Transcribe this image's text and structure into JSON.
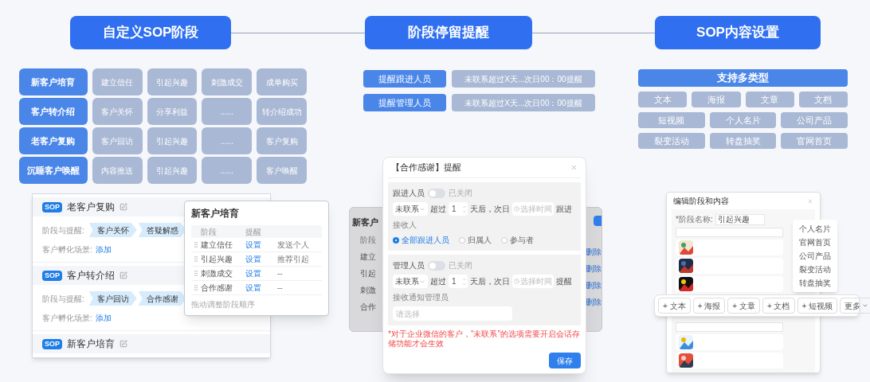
{
  "header_steps": [
    "自定义SOP阶段",
    "阶段停留提醒",
    "SOP内容设置"
  ],
  "sop_stages": [
    {
      "name": "新客户培育",
      "steps": [
        "建立信任",
        "引起兴趣",
        "刺激成交",
        "成单购买"
      ]
    },
    {
      "name": "客户转介绍",
      "steps": [
        "客户关怀",
        "分享利益",
        "......",
        "转介绍成功"
      ]
    },
    {
      "name": "老客户复购",
      "steps": [
        "客户回访",
        "引起兴趣",
        "......",
        "客户复购"
      ]
    },
    {
      "name": "沉睡客户唤醒",
      "steps": [
        "内容推送",
        "引起兴趣",
        "......",
        "客户唤醒"
      ]
    }
  ],
  "sop_list": [
    {
      "badge": "SOP",
      "title": "老客户复购",
      "stage_label": "阶段与提醒:",
      "stages": [
        "客户关怀",
        "答疑解惑"
      ],
      "scenario_label": "客户孵化场景:",
      "scenario_link": "添加"
    },
    {
      "badge": "SOP",
      "title": "客户转介绍",
      "stage_label": "阶段与提醒:",
      "stages": [
        "客户回访",
        "合作感谢"
      ],
      "scenario_label": "客户孵化场景:",
      "scenario_link": "添加"
    },
    {
      "badge": "SOP",
      "title": "新客户培育"
    }
  ],
  "stage_table": {
    "title": "新客户培育",
    "columns": [
      "阶段",
      "提醒"
    ],
    "rows": [
      {
        "stage": "建立信任",
        "action": "设置",
        "column_3": "发送个人"
      },
      {
        "stage": "引起兴趣",
        "action": "设置",
        "column_3": "推荐引起"
      },
      {
        "stage": "刺激成交",
        "action": "设置",
        "column_3": "--"
      },
      {
        "stage": "合作感谢",
        "action": "设置",
        "column_3": "--"
      }
    ],
    "footer": "拖动调整阶段顺序"
  },
  "reminders": [
    {
      "label": "提醒跟进人员",
      "value": "未联系超过X天...次日00：00提醒"
    },
    {
      "label": "提醒管理人员",
      "value": "未联系超过X天...次日00：00提醒"
    }
  ],
  "background_table": {
    "title": "新客户",
    "column_1": "阶段",
    "rows": [
      {
        "stage": "建立",
        "action": "删除"
      },
      {
        "stage": "引起",
        "action": "删除"
      },
      {
        "stage": "刺激",
        "action": "删除"
      },
      {
        "stage": "合作",
        "action": "删除"
      }
    ]
  },
  "dialog": {
    "title": "【合作感谢】提醒",
    "groups": [
      {
        "label": "跟进人员",
        "on": false,
        "state_text": "已关闭",
        "condition": "未联系",
        "over": "超过",
        "days": "1",
        "after": "天后，次日",
        "time_placeholder": "选择时间",
        "action": "跟进",
        "recipient_label": "接收人",
        "recipients": [
          {
            "label": "全部跟进人员",
            "selected": true
          },
          {
            "label": "归属人",
            "selected": false
          },
          {
            "label": "参与者",
            "selected": false
          }
        ]
      },
      {
        "label": "管理人员",
        "on": false,
        "state_text": "已关闭",
        "condition": "未联系",
        "over": "超过",
        "days": "1",
        "after": "天后，次日",
        "time_placeholder": "选择时间",
        "action": "提醒",
        "recipient_label": "接收通知管理员",
        "select_placeholder": "请选择"
      }
    ],
    "note": "*对于企业微信的客户，\"未联系\"的选项需要开启会话存储功能才会生效",
    "save": "保存"
  },
  "content_types": {
    "title": "支持多类型",
    "rows": [
      [
        "文本",
        "海报",
        "文章",
        "文档"
      ],
      [
        "短视频",
        "个人名片",
        "公司产品"
      ],
      [
        "裂变活动",
        "转盘抽奖",
        "官网首页"
      ]
    ]
  },
  "content_editor": {
    "title": "编辑阶段和内容",
    "stage_name_label": "*阶段名称:",
    "stage_name_value": "引起兴趣",
    "more_menu": [
      "个人名片",
      "官网首页",
      "公司产品",
      "裂变活动",
      "转盘抽奖"
    ],
    "toolbar": [
      "+ 文本",
      "+ 海报",
      "+ 文章",
      "+ 文档",
      "+ 短视频"
    ],
    "more": "更多"
  }
}
